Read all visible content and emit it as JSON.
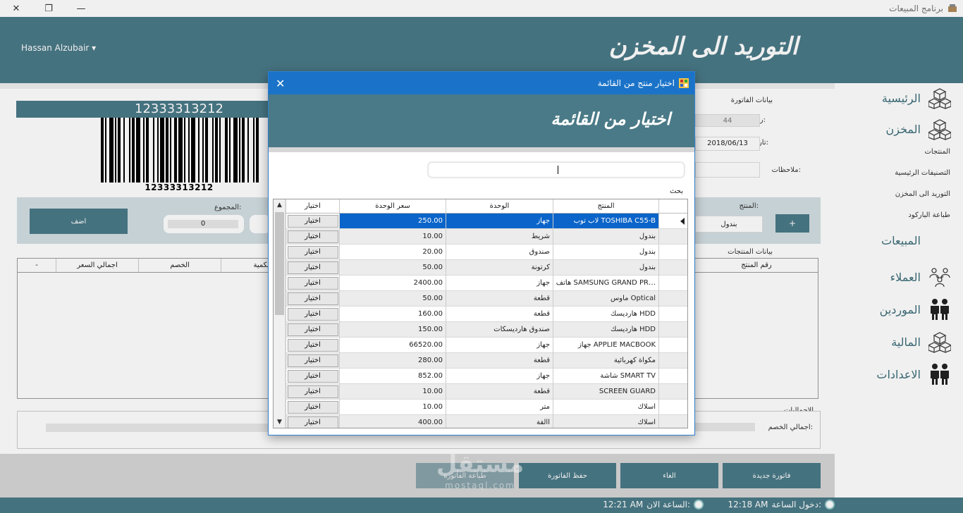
{
  "window": {
    "title": "برنامج المبيعات",
    "minimize": "—",
    "restore": "❐",
    "close": "✕"
  },
  "header": {
    "user": "Hassan Alzubair ▾",
    "page_title": "التوريد الى المخزن"
  },
  "nav": {
    "items": [
      {
        "label": "الرئيسية",
        "icon": "boxes-icon"
      },
      {
        "label": "المخزن",
        "icon": "boxes-icon"
      },
      {
        "label": "المبيعات",
        "icon": ""
      },
      {
        "label": "العملاء",
        "icon": "people-network-icon"
      },
      {
        "label": "الموردين",
        "icon": "business-people-icon"
      },
      {
        "label": "المالية",
        "icon": "boxes-icon"
      },
      {
        "label": "الاعدادات",
        "icon": "business-people-icon"
      }
    ],
    "sub_items": [
      "المنتجات",
      "التصنيفات الرئيسية",
      "التوريد الى المخزن",
      "طباعة الباركود"
    ]
  },
  "barcode": {
    "number": "12333313212",
    "caption": "12333313212"
  },
  "invoice": {
    "section_title": "بيانات الفاتورة",
    "number_label": "رقم الفاتورة:",
    "number_value": "44",
    "date_label": "تاريخ الفاتورة:",
    "date_value": "2018/06/13",
    "notes_label": "ملاحظات:"
  },
  "entry": {
    "product_label": "المنتج:",
    "product_value": "بندول",
    "add_plus": "+",
    "total_label": "المجموع:",
    "total_value": "0",
    "add_button": "اضف"
  },
  "products": {
    "section_title": "بيانات المنتجات",
    "headers": [
      "-",
      "اجمالي السعر",
      "الخصم",
      "الكمية",
      "رقم المنتج"
    ]
  },
  "totals": {
    "section_title": "الاجماليات",
    "discount_label": "اجمالي الخصم:"
  },
  "actions": {
    "new": "فاتورة جديدة",
    "cancel": "الغاء",
    "save": "حفظ الفاتورة",
    "print": "طباعة الفاتورة"
  },
  "status": {
    "login_label": "دخول الساعة:",
    "login_time": "12:18 AM",
    "now_label": "الساعة الان:",
    "now_time": "12:21 AM"
  },
  "dialog": {
    "title": "اختيار منتج من القائمة",
    "heading": "اختيار من القائمة",
    "close": "✕",
    "search_label": "بحث",
    "columns": {
      "select": "اختيار",
      "price": "سعر الوحدة",
      "unit": "الوحدة",
      "product": "المنتج"
    },
    "select_label": "اختيار",
    "rows": [
      {
        "product": "لاب توب TOSHIBA C55-B",
        "unit": "جهاز",
        "price": "250.00"
      },
      {
        "product": "بندول",
        "unit": "شريط",
        "price": "10.00"
      },
      {
        "product": "بندول",
        "unit": "صندوق",
        "price": "20.00"
      },
      {
        "product": "بندول",
        "unit": "كرتونة",
        "price": "50.00"
      },
      {
        "product": "هاتف SAMSUNG GRAND PR…",
        "unit": "جهاز",
        "price": "2400.00"
      },
      {
        "product": "ماوس Optical",
        "unit": "قطعة",
        "price": "50.00"
      },
      {
        "product": "هارديسك HDD",
        "unit": "قطعة",
        "price": "160.00"
      },
      {
        "product": "هارديسك HDD",
        "unit": "صندوق هارديسكات",
        "price": "150.00"
      },
      {
        "product": "جهاز APPLIE MACBOOK",
        "unit": "جهاز",
        "price": "66520.00"
      },
      {
        "product": "مكواة كهربائية",
        "unit": "قطعة",
        "price": "280.00"
      },
      {
        "product": "شاشة SMART TV",
        "unit": "جهاز",
        "price": "852.00"
      },
      {
        "product": "SCREEN GUARD",
        "unit": "قطعة",
        "price": "10.00"
      },
      {
        "product": "اسلاك",
        "unit": "متر",
        "price": "10.00"
      },
      {
        "product": "اسلاك",
        "unit": "االفة",
        "price": "400.00"
      }
    ]
  },
  "watermark": {
    "logo": "مستقل",
    "sub": "mostaql.com"
  },
  "colors": {
    "teal": "#4a7a87",
    "dialog_blue": "#1a73c8",
    "selection": "#0a64c9"
  }
}
